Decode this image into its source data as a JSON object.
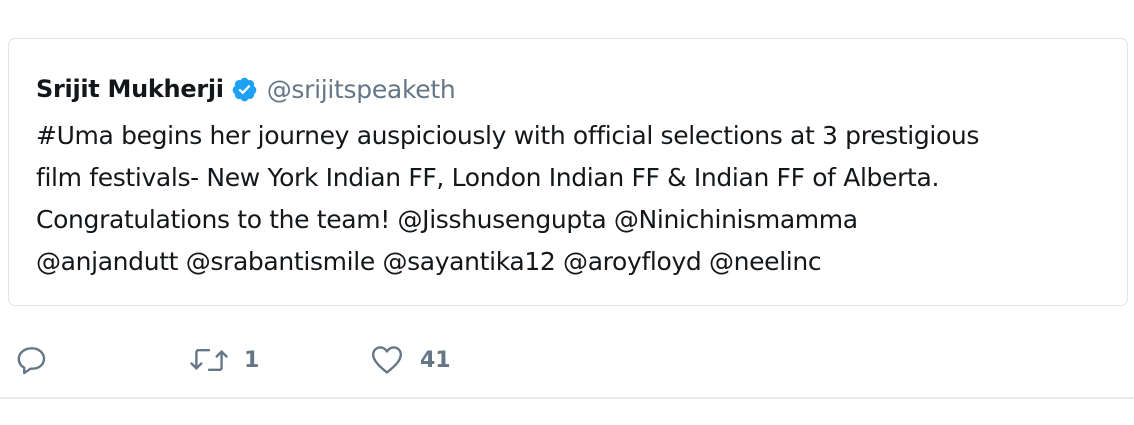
{
  "quoted_tweet": {
    "author_name": "Srijit Mukherji",
    "author_handle": "@srijitspeaketh",
    "verified_icon": "verified-badge-icon",
    "text_lines": [
      "#Uma begins her journey auspiciously with official selections at 3 prestigious",
      "film festivals- New York Indian FF, London Indian FF & Indian FF of Alberta.",
      "Congratulations to the team! @Jisshusengupta @Ninichinismamma",
      "@anjandutt @srabantismile @sayantika12 @aroyfloyd @neelinc"
    ]
  },
  "actions": {
    "reply": {
      "icon": "reply-icon"
    },
    "retweet": {
      "icon": "retweet-icon",
      "count": "1"
    },
    "like": {
      "icon": "heart-icon",
      "count": "41"
    }
  },
  "colors": {
    "text": "#14171a",
    "secondary": "#657786",
    "verified": "#1da1f2",
    "border": "#dfe3e7"
  }
}
